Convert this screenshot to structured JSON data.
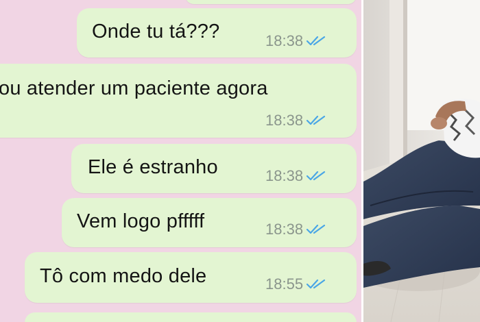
{
  "chat": {
    "background": "#f1d5e4",
    "bubble_color": "#e3f5d2",
    "tick_color": "#4aa6e6",
    "messages": [
      {
        "text": "Onde tu tá???",
        "time": "18:38",
        "status_icon": "double-check-icon"
      },
      {
        "text": "ou atender um paciente agora",
        "time": "18:38",
        "status_icon": "double-check-icon"
      },
      {
        "text": "Ele é estranho",
        "time": "18:38",
        "status_icon": "double-check-icon"
      },
      {
        "text": "Vem logo pfffff",
        "time": "18:38",
        "status_icon": "double-check-icon"
      },
      {
        "text": "Tô com medo dele",
        "time": "18:55",
        "status_icon": "double-check-icon"
      }
    ]
  },
  "photo": {
    "subject": "person-sitting-on-floor"
  }
}
